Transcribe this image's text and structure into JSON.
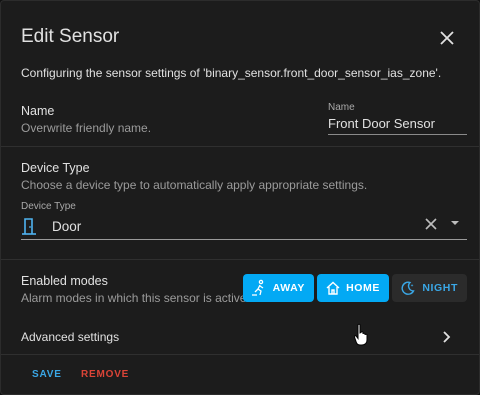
{
  "dialog": {
    "title": "Edit Sensor",
    "description": "Configuring the sensor settings of 'binary_sensor.front_door_sensor_ias_zone'."
  },
  "name_section": {
    "label": "Name",
    "sublabel": "Overwrite friendly name.",
    "field_label": "Name",
    "field_value": "Front Door Sensor"
  },
  "device_type_section": {
    "label": "Device Type",
    "sublabel": "Choose a device type to automatically apply appropriate settings.",
    "field_label": "Device Type",
    "field_value": "Door"
  },
  "modes_section": {
    "label": "Enabled modes",
    "sublabel": "Alarm modes in which this sensor is active.",
    "modes": [
      {
        "label": "AWAY",
        "enabled": true
      },
      {
        "label": "HOME",
        "enabled": true
      },
      {
        "label": "NIGHT",
        "enabled": false
      }
    ]
  },
  "advanced": {
    "label": "Advanced settings"
  },
  "footer": {
    "save_label": "SAVE",
    "remove_label": "REMOVE"
  },
  "colors": {
    "accent": "#03a9f4",
    "danger": "#db4437",
    "background": "#1c1c1c"
  }
}
